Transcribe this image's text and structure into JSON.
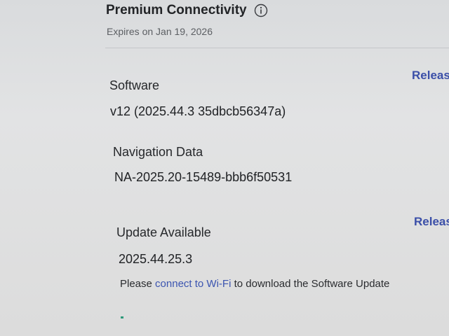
{
  "connectivity": {
    "title": "Premium Connectivity",
    "expires": "Expires on Jan 19, 2026"
  },
  "software": {
    "label": "Software",
    "version": "v12 (2025.44.3 35dbcb56347a)",
    "release_notes_link": "Releas"
  },
  "navigation": {
    "label": "Navigation Data",
    "version": "NA-2025.20-15489-bbb6f50531"
  },
  "update": {
    "label": "Update Available",
    "version": "2025.44.25.3",
    "release_notes_link": "Releas",
    "message_prefix": "Please ",
    "message_link": "connect to Wi-Fi",
    "message_suffix": " to download the Software Update",
    "progress_fraction": 0.01
  },
  "colors": {
    "accent_link": "#3b4fa8",
    "progress": "#2f9a7b"
  },
  "icons": {
    "info": "info-icon"
  }
}
